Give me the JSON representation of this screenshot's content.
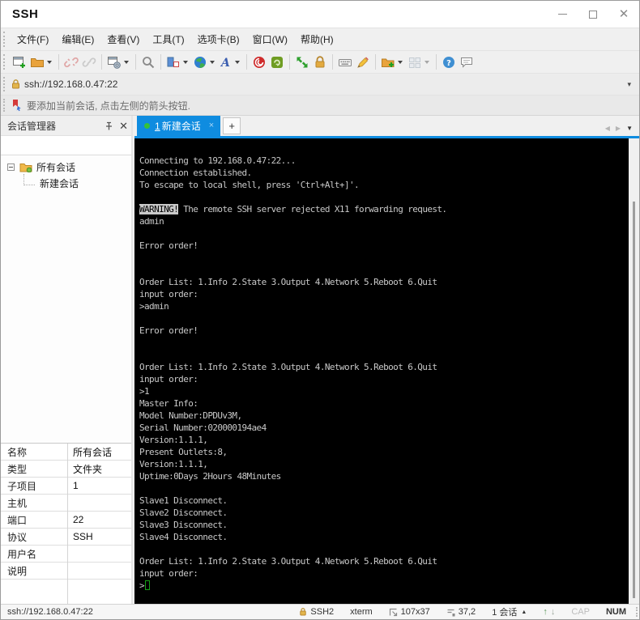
{
  "window": {
    "title": "SSH"
  },
  "menu": {
    "items": [
      "文件(F)",
      "编辑(E)",
      "查看(V)",
      "工具(T)",
      "选项卡(B)",
      "窗口(W)",
      "帮助(H)"
    ]
  },
  "toolbar": {
    "icons": [
      "new-session",
      "open-session",
      "disconnect",
      "reconnect",
      "session-properties",
      "find",
      "layout",
      "web-browser",
      "font",
      "xagent",
      "xftp",
      "fullscreen",
      "lock-screen",
      "virtual-keyboard",
      "highlighter",
      "new-file-transfer",
      "tile-windows",
      "help",
      "feedback"
    ]
  },
  "address_bar": {
    "url": "ssh://192.168.0.47:22"
  },
  "hint_bar": {
    "text": "要添加当前会话, 点击左侧的箭头按钮."
  },
  "session_manager": {
    "title": "会话管理器",
    "search_placeholder": "",
    "root_label": "所有会话",
    "child_label": "新建会话"
  },
  "tab_bar": {
    "active_tab_index": "1",
    "active_tab_label": "新建会话",
    "close_label": "×",
    "new_tab_label": "+"
  },
  "terminal": {
    "lines": [
      "Connecting to 192.168.0.47:22...",
      "Connection established.",
      "To escape to local shell, press 'Ctrl+Alt+]'.",
      "",
      [
        {
          "t": "WARNING!",
          "k": "inv"
        },
        {
          "t": " The remote SSH server rejected X11 forwarding request.",
          "k": "n"
        }
      ],
      "admin",
      "",
      "Error order!",
      "",
      "",
      "Order List: 1.Info 2.State 3.Output 4.Network 5.Reboot 6.Quit",
      "input order:",
      ">admin",
      "",
      "Error order!",
      "",
      "",
      "Order List: 1.Info 2.State 3.Output 4.Network 5.Reboot 6.Quit",
      "input order:",
      ">1",
      "Master Info:",
      "Model Number:DPDUv3M,",
      "Serial Number:020000194ae4",
      "Version:1.1.1,",
      "Present Outlets:8,",
      "Version:1.1.1,",
      "Uptime:0Days 2Hours 48Minutes",
      "",
      "Slave1 Disconnect.",
      "Slave2 Disconnect.",
      "Slave3 Disconnect.",
      "Slave4 Disconnect.",
      "",
      "Order List: 1.Info 2.State 3.Output 4.Network 5.Reboot 6.Quit",
      "input order:",
      [
        {
          "t": ">",
          "k": "n"
        },
        {
          "t": "",
          "k": "cur"
        }
      ]
    ]
  },
  "properties": {
    "rows": [
      {
        "label": "名称",
        "value": "所有会话"
      },
      {
        "label": "类型",
        "value": "文件夹"
      },
      {
        "label": "子项目",
        "value": "1"
      },
      {
        "label": "主机",
        "value": ""
      },
      {
        "label": "端口",
        "value": "22"
      },
      {
        "label": "协议",
        "value": "SSH"
      },
      {
        "label": "用户名",
        "value": ""
      },
      {
        "label": "说明",
        "value": ""
      }
    ]
  },
  "status_bar": {
    "url": "ssh://192.168.0.47:22",
    "encryption": "SSH2",
    "terminal_type": "xterm",
    "screen_size": "107x37",
    "cursor_position": "37,2",
    "session_count": "1 会话",
    "caps_indicator": "CAP",
    "num_indicator": "NUM"
  }
}
